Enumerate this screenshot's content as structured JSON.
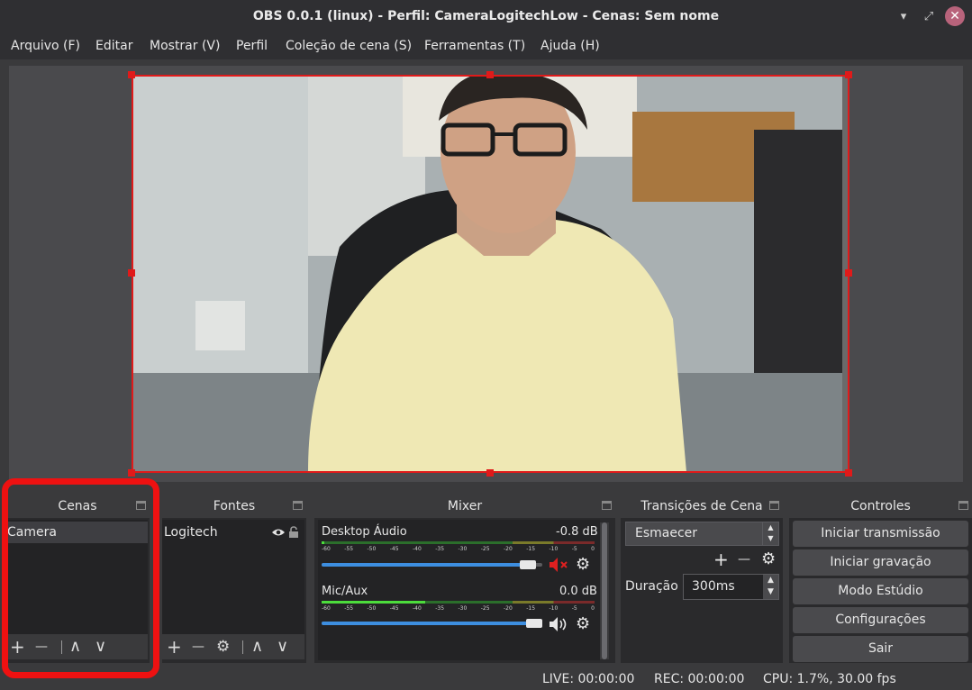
{
  "window": {
    "title": "OBS 0.0.1 (linux) - Perfil: CameraLogitechLow - Cenas: Sem nome",
    "minimize_glyph": "▾",
    "maximize_glyph": "⤢",
    "close_glyph": "✕"
  },
  "menu": {
    "items": [
      "Arquivo (F)",
      "Editar",
      "Mostrar (V)",
      "Perfil",
      "Coleção de cena (S)",
      "Ferramentas (T)",
      "Ajuda (H)"
    ]
  },
  "scenes": {
    "title": "Cenas",
    "items": [
      "Camera"
    ],
    "toolbar": {
      "add": "+",
      "remove": "—",
      "up": "∧",
      "down": "∨"
    }
  },
  "sources": {
    "title": "Fontes",
    "items": [
      {
        "label": "Logitech",
        "visibility_icon": "eye-icon",
        "lock_icon": "lock-icon"
      }
    ],
    "toolbar": {
      "add": "+",
      "remove": "—",
      "settings": "⚙",
      "up": "∧",
      "down": "∨"
    }
  },
  "mixer": {
    "title": "Mixer",
    "tick_labels": [
      "-60",
      "-55",
      "-50",
      "-45",
      "-40",
      "-35",
      "-30",
      "-25",
      "-20",
      "-15",
      "-10",
      "-5",
      "0"
    ],
    "channels": [
      {
        "name": "Desktop Áudio",
        "db": "-0.8 dB",
        "muted": true,
        "volume_fraction": 0.97,
        "meter_fraction": 0.01,
        "mute_glyph": "🔈✕",
        "gear_glyph": "⚙"
      },
      {
        "name": "Mic/Aux",
        "db": "0.0 dB",
        "muted": false,
        "volume_fraction": 1.0,
        "meter_fraction": 0.38,
        "mute_glyph": "🔊",
        "gear_glyph": "⚙"
      }
    ]
  },
  "transitions": {
    "title": "Transições de Cena",
    "selected": "Esmaecer",
    "add": "+",
    "remove": "—",
    "settings": "⚙",
    "duration_label": "Duração",
    "duration_value": "300ms",
    "spin_up": "▲",
    "spin_down": "▼"
  },
  "controls": {
    "title": "Controles",
    "buttons": [
      "Iniciar transmissão",
      "Iniciar gravação",
      "Modo Estúdio",
      "Configurações",
      "Sair"
    ]
  },
  "status": {
    "live": "LIVE: 00:00:00",
    "rec": "REC: 00:00:00",
    "cpu": "CPU: 1.7%, 30.00 fps"
  },
  "colors": {
    "selection": "#e01a1a",
    "annotation": "#ee1111",
    "volume": "#3d8ee0",
    "meter_green": "#4cdc3c"
  }
}
